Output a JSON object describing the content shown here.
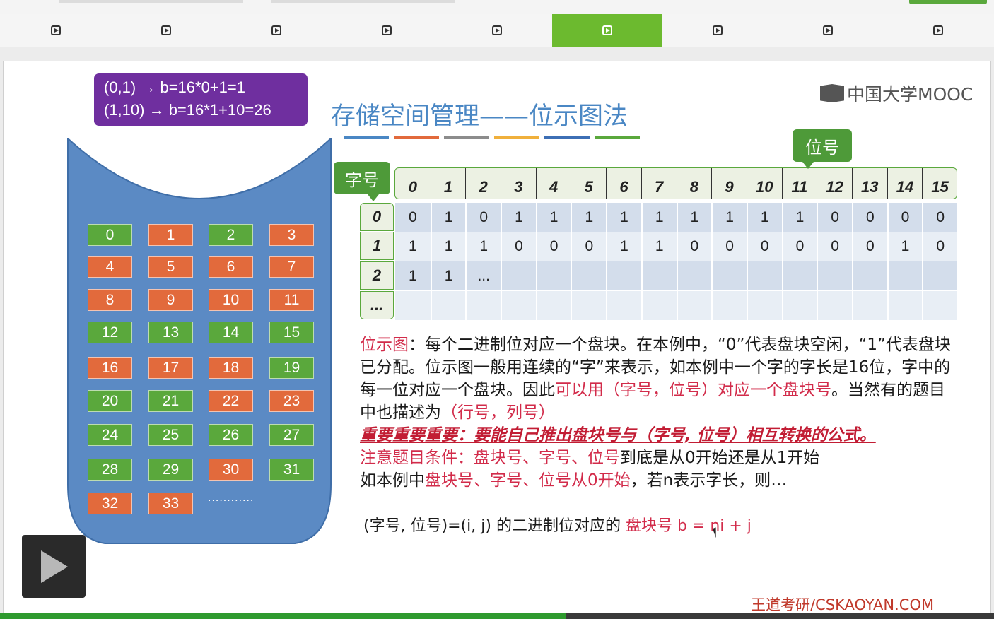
{
  "nav_tabs": {
    "count": 9,
    "active_index": 5,
    "icon": "play-square-icon"
  },
  "formula_box": {
    "line1": "(0,1) → b=16*0+1=1",
    "line2": "(1,10) → b=16*1+10=26"
  },
  "title": "存储空间管理——位示图法",
  "title_bar_colors": [
    "#4a87c4",
    "#e26a3c",
    "#8c8c8c",
    "#f0b03c",
    "#3d6fb5",
    "#5aa83c"
  ],
  "brand": "中国大学MOOC",
  "disk_blocks": [
    {
      "label": "0",
      "color": "green"
    },
    {
      "label": "1",
      "color": "orange"
    },
    {
      "label": "2",
      "color": "green"
    },
    {
      "label": "3",
      "color": "orange"
    },
    {
      "label": "4",
      "color": "orange"
    },
    {
      "label": "5",
      "color": "orange"
    },
    {
      "label": "6",
      "color": "orange"
    },
    {
      "label": "7",
      "color": "orange"
    },
    {
      "label": "8",
      "color": "orange"
    },
    {
      "label": "9",
      "color": "orange"
    },
    {
      "label": "10",
      "color": "orange"
    },
    {
      "label": "11",
      "color": "orange"
    },
    {
      "label": "12",
      "color": "green"
    },
    {
      "label": "13",
      "color": "green"
    },
    {
      "label": "14",
      "color": "green"
    },
    {
      "label": "15",
      "color": "green"
    },
    {
      "label": "16",
      "color": "orange"
    },
    {
      "label": "17",
      "color": "orange"
    },
    {
      "label": "18",
      "color": "orange"
    },
    {
      "label": "19",
      "color": "green"
    },
    {
      "label": "20",
      "color": "green"
    },
    {
      "label": "21",
      "color": "green"
    },
    {
      "label": "22",
      "color": "orange"
    },
    {
      "label": "23",
      "color": "orange"
    },
    {
      "label": "24",
      "color": "green"
    },
    {
      "label": "25",
      "color": "green"
    },
    {
      "label": "26",
      "color": "green"
    },
    {
      "label": "27",
      "color": "green"
    },
    {
      "label": "28",
      "color": "green"
    },
    {
      "label": "29",
      "color": "green"
    },
    {
      "label": "30",
      "color": "orange"
    },
    {
      "label": "31",
      "color": "green"
    },
    {
      "label": "32",
      "color": "orange"
    },
    {
      "label": "33",
      "color": "orange"
    }
  ],
  "disk_ellipsis": "............",
  "callouts": {
    "word": "字号",
    "bit": "位号"
  },
  "bitmap": {
    "bit_headers": [
      "0",
      "1",
      "2",
      "3",
      "4",
      "5",
      "6",
      "7",
      "8",
      "9",
      "10",
      "11",
      "12",
      "13",
      "14",
      "15"
    ],
    "row_labels": [
      "0",
      "1",
      "2",
      "..."
    ],
    "rows": [
      [
        "0",
        "1",
        "0",
        "1",
        "1",
        "1",
        "1",
        "1",
        "1",
        "1",
        "1",
        "1",
        "0",
        "0",
        "0",
        "0"
      ],
      [
        "1",
        "1",
        "1",
        "0",
        "0",
        "0",
        "1",
        "1",
        "0",
        "0",
        "0",
        "0",
        "0",
        "0",
        "1",
        "0"
      ],
      [
        "1",
        "1",
        "...",
        "",
        "",
        "",
        "",
        "",
        "",
        "",
        "",
        "",
        "",
        "",
        "",
        ""
      ],
      [
        "",
        "",
        "",
        "",
        "",
        "",
        "",
        "",
        "",
        "",
        "",
        "",
        "",
        "",
        "",
        ""
      ]
    ]
  },
  "paragraph": {
    "p1": "位示图",
    "p2": "：每个二进制位对应一个盘块。在本例中，“0”代表盘块空闲，“1”代表盘块已分配。位示图一般用连续的“字”来表示，如本例中一个字的字长是16位，字中的每一位对应一个盘块。因此",
    "p3": "可以用（字号，位号）对应一个盘块号",
    "p4": "。当然有的题目中也描述为",
    "p5": "（行号，列号）",
    "important": "重要重要重要：要能自己推出盘块号与（字号, 位号）相互转换的公式。",
    "note_red": "注意题目条件：盘块号、字号、位号",
    "note_black": "到底是从0开始还是从1开始",
    "ex_black1": "如本例中",
    "ex_red": "盘块号、字号、位号从0开始",
    "ex_black2": "，若n表示字长，则…"
  },
  "formula": {
    "left": "(字号, 位号)=(i, j) 的二进制位对应的 ",
    "right": "盘块号 b = ni + j"
  },
  "footer": "王道考研/CSKAOYAN.COM",
  "progress_percent": 57
}
